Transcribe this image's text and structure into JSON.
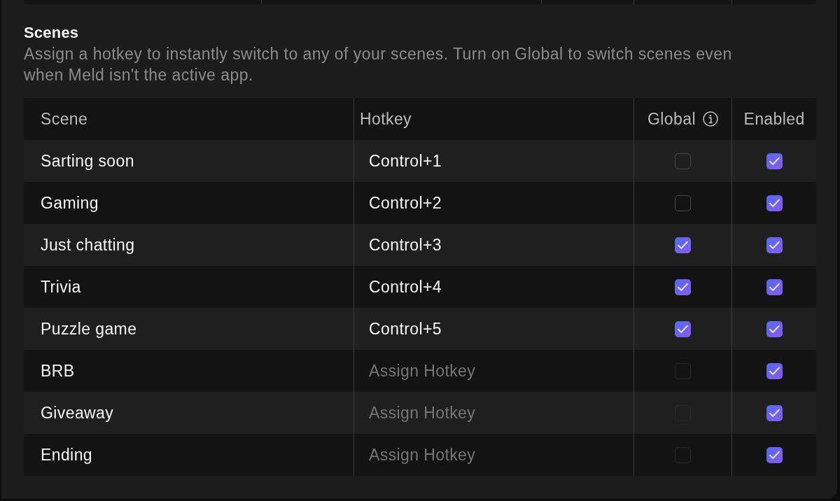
{
  "section": {
    "title": "Scenes",
    "description": "Assign a hotkey to instantly switch to any of your scenes. Turn on Global to switch scenes even when Meld isn't the active app."
  },
  "table": {
    "columns": [
      {
        "label": "Scene",
        "kind": "name"
      },
      {
        "label": "Hotkey",
        "kind": "hotkey"
      },
      {
        "label": "Global",
        "kind": "toggle",
        "info": true
      },
      {
        "label": "Enabled",
        "kind": "toggle"
      }
    ],
    "rows": [
      {
        "scene": "Sarting soon",
        "hotkey": {
          "value": "Control+1"
        },
        "global": {
          "checked": false,
          "disabled": false
        },
        "enabled": {
          "checked": true
        }
      },
      {
        "scene": "Gaming",
        "hotkey": {
          "value": "Control+2"
        },
        "global": {
          "checked": false,
          "disabled": false
        },
        "enabled": {
          "checked": true
        }
      },
      {
        "scene": "Just chatting",
        "hotkey": {
          "value": "Control+3"
        },
        "global": {
          "checked": true,
          "disabled": false
        },
        "enabled": {
          "checked": true
        }
      },
      {
        "scene": "Trivia",
        "hotkey": {
          "value": "Control+4"
        },
        "global": {
          "checked": true,
          "disabled": false
        },
        "enabled": {
          "checked": true
        }
      },
      {
        "scene": "Puzzle game",
        "hotkey": {
          "value": "Control+5"
        },
        "global": {
          "checked": true,
          "disabled": false
        },
        "enabled": {
          "checked": true
        }
      },
      {
        "scene": "BRB",
        "hotkey": {
          "placeholder": "Assign Hotkey"
        },
        "global": {
          "checked": false,
          "disabled": true
        },
        "enabled": {
          "checked": true
        }
      },
      {
        "scene": "Giveaway",
        "hotkey": {
          "placeholder": "Assign Hotkey"
        },
        "global": {
          "checked": false,
          "disabled": true
        },
        "enabled": {
          "checked": true
        }
      },
      {
        "scene": "Ending",
        "hotkey": {
          "placeholder": "Assign Hotkey"
        },
        "global": {
          "checked": false,
          "disabled": true
        },
        "enabled": {
          "checked": true
        }
      }
    ]
  }
}
